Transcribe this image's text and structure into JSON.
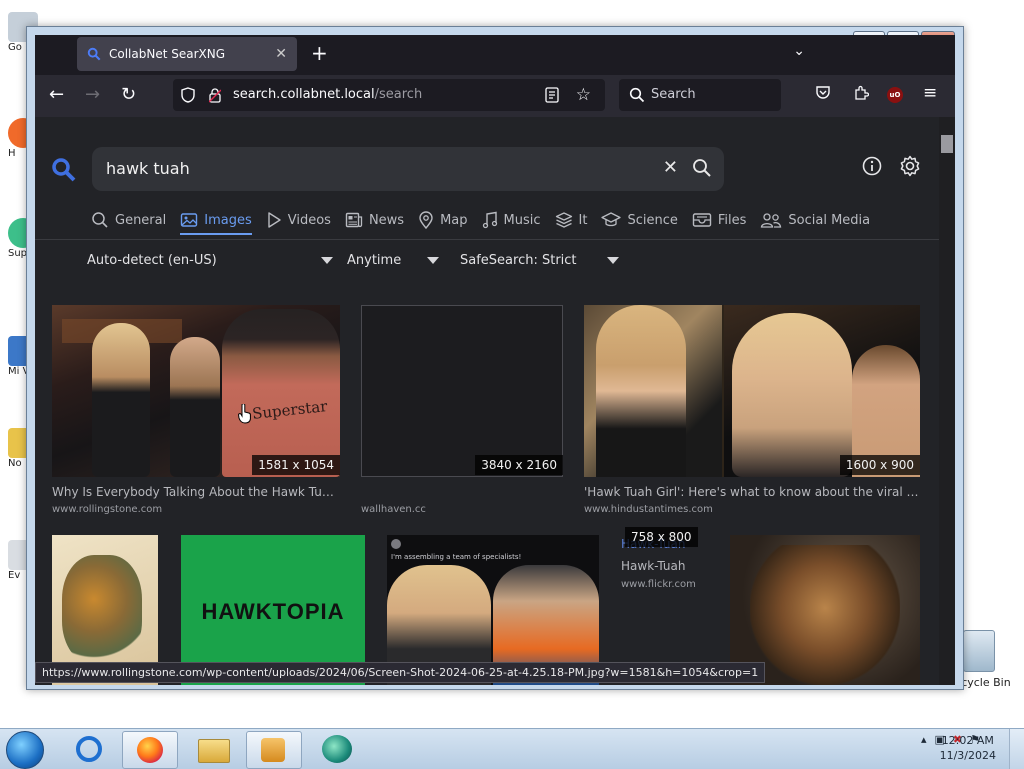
{
  "desktop": {
    "icons": [
      {
        "label": "Go",
        "color": "#c5cfd9"
      },
      {
        "label": "H",
        "color": "#f06a2a"
      },
      {
        "label": "Sup",
        "color": "#3dbf8a"
      },
      {
        "label": "Mi Visu",
        "color": "#3c78c8"
      },
      {
        "label": "No",
        "color": "#e8c34a"
      },
      {
        "label": "Ev",
        "color": "#d9dde2"
      }
    ],
    "recycle_bin": "Recycle Bin"
  },
  "browser": {
    "tab_title": "CollabNet SearXNG",
    "url_host": "search.collabnet.local",
    "url_path": "/search",
    "search_placeholder": "Search",
    "window_controls": {
      "minimize": "—",
      "maximize": "□",
      "close": "✕"
    }
  },
  "searx": {
    "query": "hawk tuah",
    "categories": [
      {
        "label": "General",
        "icon": "search-icon",
        "active": false
      },
      {
        "label": "Images",
        "icon": "image-icon",
        "active": true
      },
      {
        "label": "Videos",
        "icon": "play-icon",
        "active": false
      },
      {
        "label": "News",
        "icon": "newspaper-icon",
        "active": false
      },
      {
        "label": "Map",
        "icon": "map-pin-icon",
        "active": false
      },
      {
        "label": "Music",
        "icon": "music-icon",
        "active": false
      },
      {
        "label": "It",
        "icon": "layers-icon",
        "active": false
      },
      {
        "label": "Science",
        "icon": "school-icon",
        "active": false
      },
      {
        "label": "Files",
        "icon": "file-tray-icon",
        "active": false
      },
      {
        "label": "Social Media",
        "icon": "people-icon",
        "active": false
      }
    ],
    "filters": {
      "language": "Auto-detect (en-US)",
      "time": "Anytime",
      "safesearch": "SafeSearch: Strict"
    },
    "results_row1": [
      {
        "dims": "1581 x 1054",
        "title": "Why Is Everybody Talking About the Hawk Tuah...",
        "url": "www.rollingstone.com"
      },
      {
        "dims": "3840 x 2160",
        "title": "",
        "url": "wallhaven.cc"
      },
      {
        "dims": "1600 x 900",
        "title": "'Hawk Tuah Girl': Here's what to know about the viral Tik...",
        "url": "www.hindustantimes.com"
      }
    ],
    "results_row2": [
      {
        "dims": "",
        "title": "",
        "url": ""
      },
      {
        "dims": "",
        "title": "",
        "url": "",
        "image_text": "HAWKTOPIA"
      },
      {
        "dims": "",
        "title": "",
        "url": "",
        "caption_lines": [
          "I'm assembling a team of specialists!"
        ]
      },
      {
        "dims": "758 x 800",
        "title": "Hawk-Tuah",
        "url": "www.flickr.com",
        "alt_text": "Hawk-Tuah"
      },
      {
        "dims": "",
        "title": "",
        "url": ""
      }
    ],
    "status_url": "https://www.rollingstone.com/wp-content/uploads/2024/06/Screen-Shot-2024-06-25-at-4.25.18-PM.jpg?w=1581&h=1054&crop=1"
  },
  "taskbar": {
    "time": "12:02 AM",
    "date": "11/3/2024"
  },
  "colors": {
    "accent": "#6a9cf0",
    "page_bg": "#222327",
    "firefox_toolbar": "#2b2a33"
  }
}
